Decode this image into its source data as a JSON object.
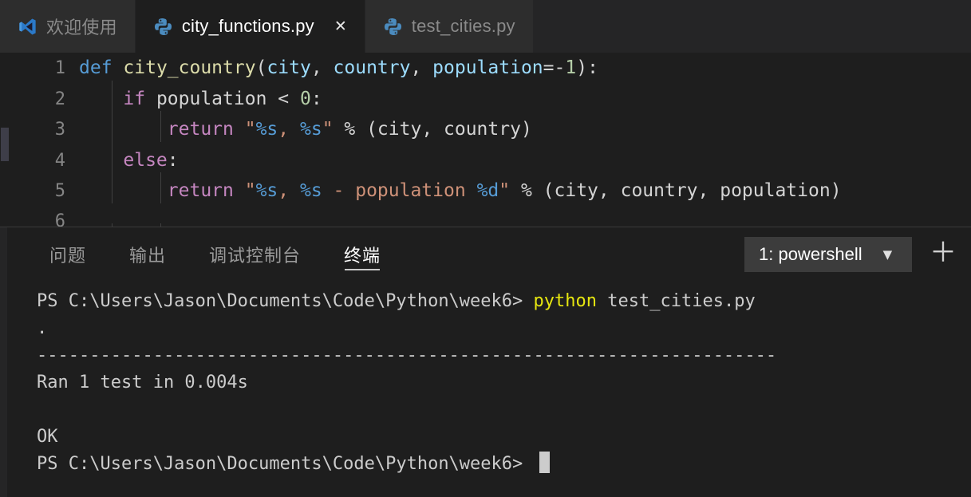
{
  "window": {
    "theme": "dark",
    "colors": {
      "editor_background": "#1e1e1e",
      "tabbar_background": "#252526",
      "inactive_tab_background": "#2d2d2d",
      "accent_blue": "#569CD6",
      "function_yellow": "#DCDCAA",
      "string_salmon": "#CE9178",
      "keyword_purple": "#C586C0",
      "number_green": "#B5CEA8",
      "terminal_command_yellow": "#e5e510"
    }
  },
  "tabs": [
    {
      "label": "欢迎使用",
      "icon": "vscode-logo-icon",
      "active": false,
      "closable": false
    },
    {
      "label": "city_functions.py",
      "icon": "python-file-icon",
      "active": true,
      "closable": true,
      "close_label": "✕"
    },
    {
      "label": "test_cities.py",
      "icon": "python-file-icon",
      "active": false,
      "closable": false
    }
  ],
  "editor": {
    "language": "python",
    "line_numbers": [
      "1",
      "2",
      "3",
      "4",
      "5",
      "6"
    ],
    "lines": [
      {
        "number": "1",
        "text": "def city_country(city, country, population=-1):"
      },
      {
        "number": "2",
        "text": "    if population < 0:"
      },
      {
        "number": "3",
        "text": "        return \"%s, %s\" % (city, country)"
      },
      {
        "number": "4",
        "text": "    else:"
      },
      {
        "number": "5",
        "text": "        return \"%s, %s - population %d\" % (city, country, population)"
      },
      {
        "number": "6",
        "text": ""
      }
    ],
    "tokens": {
      "l1_def": "def",
      "l1_name": "city_country",
      "l1_open": "(",
      "l1_p1": "city",
      "l1_c1": ", ",
      "l1_p2": "country",
      "l1_c2": ", ",
      "l1_p3": "population",
      "l1_eq": "=",
      "l1_minus": "-",
      "l1_num": "1",
      "l1_close": "):",
      "l2_if": "if",
      "l2_var": " population ",
      "l2_lt": "< ",
      "l2_num": "0",
      "l2_colon": ":",
      "l3_return": "return",
      "l3_q1": " \"",
      "l3_fmt1": "%s",
      "l3_sep": ", ",
      "l3_fmt2": "%s",
      "l3_q2": "\"",
      "l3_rest": " % (city, country)",
      "l4_else": "else",
      "l4_colon": ":",
      "l5_return": "return",
      "l5_q1": " \"",
      "l5_fmt1": "%s",
      "l5_sep": ", ",
      "l5_fmt2": "%s",
      "l5_mid": " - population ",
      "l5_fmt3": "%d",
      "l5_q2": "\"",
      "l5_rest": " % (city, country, population)"
    }
  },
  "panel": {
    "tabs": [
      {
        "label": "问题",
        "active": false
      },
      {
        "label": "输出",
        "active": false
      },
      {
        "label": "调试控制台",
        "active": false
      },
      {
        "label": "终端",
        "active": true
      }
    ],
    "terminal_selector": {
      "value": "1: powershell",
      "caret": "▼"
    },
    "add_button": "＋"
  },
  "terminal": {
    "lines": [
      {
        "type": "prompt",
        "prompt": "PS C:\\Users\\Jason\\Documents\\Code\\Python\\week6> ",
        "command": "python",
        "args": " test_cities.py"
      },
      {
        "type": "output",
        "text": "."
      },
      {
        "type": "separator",
        "text": "----------------------------------------------------------------------"
      },
      {
        "type": "output",
        "text": "Ran 1 test in 0.004s"
      },
      {
        "type": "blank",
        "text": ""
      },
      {
        "type": "output",
        "text": "OK"
      },
      {
        "type": "prompt_only",
        "prompt": "PS C:\\Users\\Jason\\Documents\\Code\\Python\\week6> "
      }
    ]
  }
}
